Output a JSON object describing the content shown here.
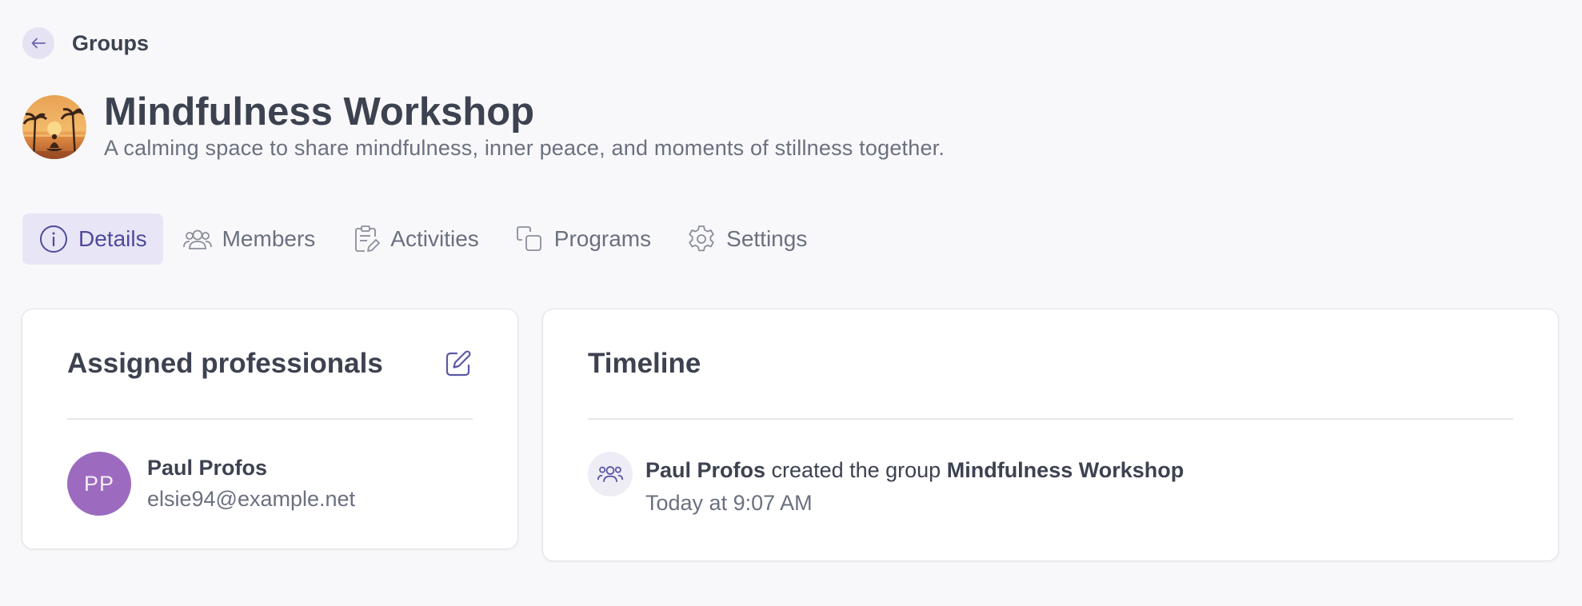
{
  "breadcrumb": {
    "label": "Groups"
  },
  "group": {
    "title": "Mindfulness Workshop",
    "description": "A calming space to share mindfulness, inner peace, and moments of stillness together."
  },
  "tabs": [
    {
      "label": "Details",
      "icon": "info-icon",
      "active": true
    },
    {
      "label": "Members",
      "icon": "users-icon",
      "active": false
    },
    {
      "label": "Activities",
      "icon": "clipboard-edit-icon",
      "active": false
    },
    {
      "label": "Programs",
      "icon": "copy-icon",
      "active": false
    },
    {
      "label": "Settings",
      "icon": "gear-icon",
      "active": false
    }
  ],
  "assigned": {
    "title": "Assigned professionals",
    "professionals": [
      {
        "initials": "PP",
        "name": "Paul Profos",
        "email": "elsie94@example.net"
      }
    ]
  },
  "timeline": {
    "title": "Timeline",
    "events": [
      {
        "actor": "Paul Profos",
        "action": "created the group",
        "target": "Mindfulness Workshop",
        "time": "Today at 9:07 AM"
      }
    ]
  },
  "colors": {
    "accent": "#4d4a9c",
    "accent_bg": "#e8e6f6",
    "avatar_bg": "#9c6bbf",
    "page_bg": "#f8f8fa"
  }
}
